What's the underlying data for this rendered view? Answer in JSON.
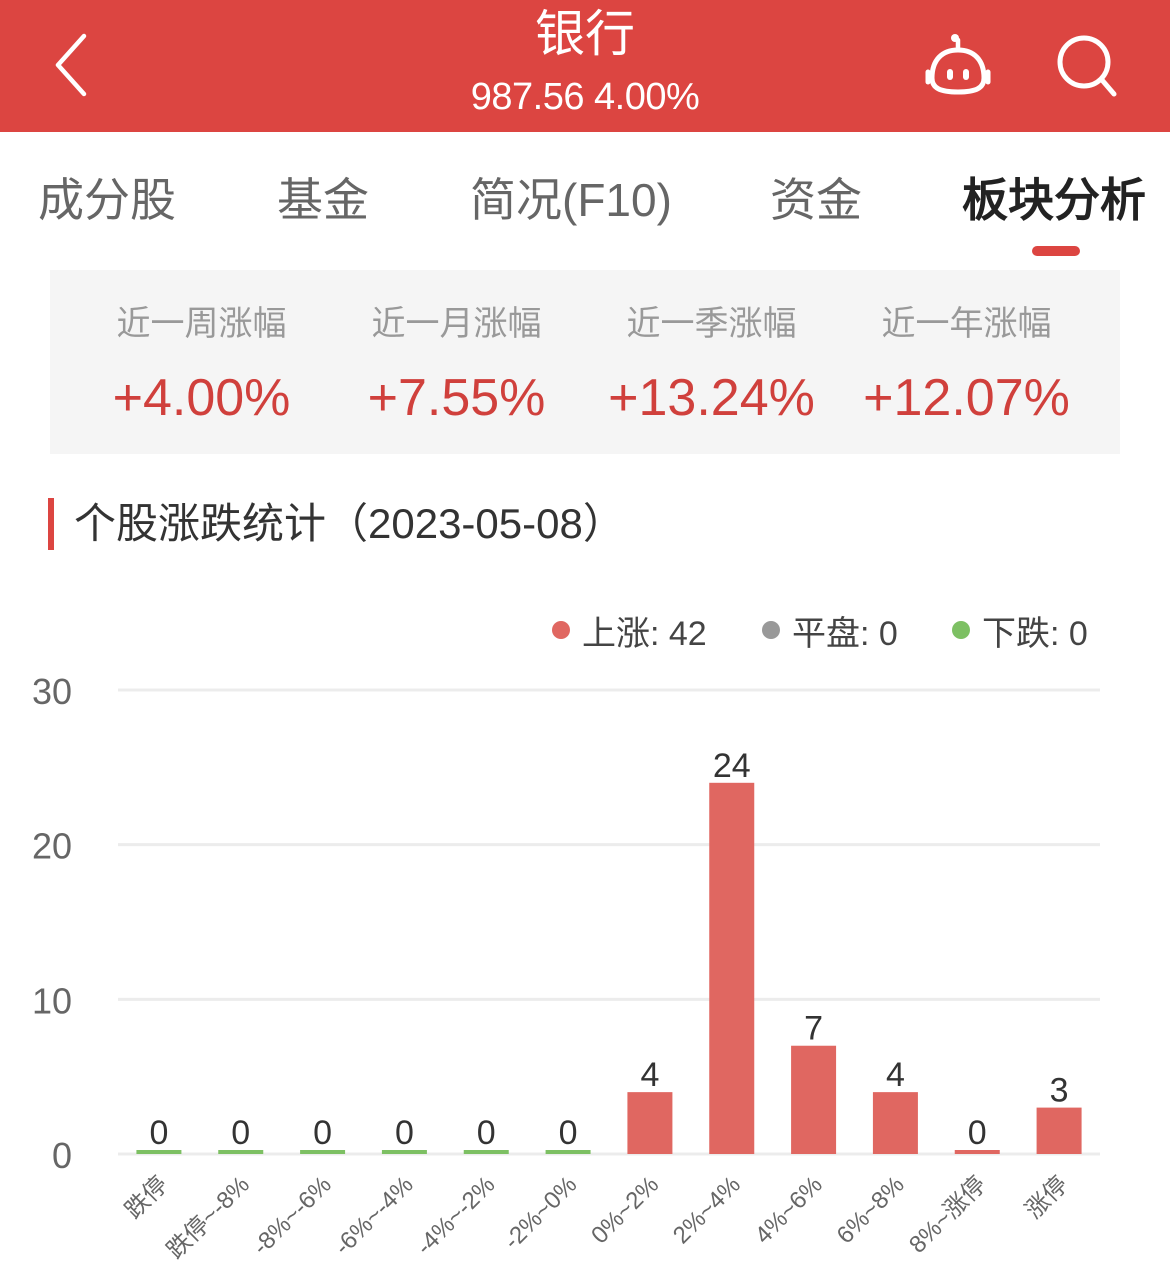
{
  "header": {
    "title": "银行",
    "price": "987.56",
    "change_pct": "4.00%",
    "subtitle": "987.56 4.00%",
    "icons": [
      "back-chevron-icon",
      "robot-assistant-icon",
      "search-icon"
    ]
  },
  "tabs": [
    {
      "label": "成分股",
      "active": false
    },
    {
      "label": "基金",
      "active": false
    },
    {
      "label": "简况(F10)",
      "active": false
    },
    {
      "label": "资金",
      "active": false
    },
    {
      "label": "板块分析",
      "active": true
    }
  ],
  "stats": [
    {
      "label": "近一周涨幅",
      "value": "+4.00%"
    },
    {
      "label": "近一月涨幅",
      "value": "+7.55%"
    },
    {
      "label": "近一季涨幅",
      "value": "+13.24%"
    },
    {
      "label": "近一年涨幅",
      "value": "+12.07%"
    }
  ],
  "section": {
    "title": "个股涨跌统计（2023-05-08）"
  },
  "legend": [
    {
      "label": "上涨",
      "value": "42",
      "text": "上涨: 42",
      "color": "#e06761"
    },
    {
      "label": "平盘",
      "value": "0",
      "text": "平盘: 0",
      "color": "#999999"
    },
    {
      "label": "下跌",
      "value": "0",
      "text": "下跌: 0",
      "color": "#7dc063"
    }
  ],
  "colors": {
    "brand_red": "#dc4541",
    "up": "#e06761",
    "down": "#7dc063",
    "flat": "#999999"
  },
  "chart_data": {
    "type": "bar",
    "title": "个股涨跌统计（2023-05-08）",
    "xlabel": "",
    "ylabel": "",
    "categories": [
      "跌停",
      "跌停~-8%",
      "-8%~-6%",
      "-6%~-4%",
      "-4%~-2%",
      "-2%~0%",
      "0%~2%",
      "2%~4%",
      "4%~6%",
      "6%~8%",
      "8%~涨停",
      "涨停"
    ],
    "values": [
      0,
      0,
      0,
      0,
      0,
      0,
      4,
      24,
      7,
      4,
      0,
      3
    ],
    "bar_colors": [
      "down",
      "down",
      "down",
      "down",
      "down",
      "down",
      "up",
      "up",
      "up",
      "up",
      "up",
      "up"
    ],
    "yticks": [
      0,
      10,
      20,
      30
    ],
    "ylim": [
      0,
      30
    ],
    "grid": true,
    "legend_position": "top-right",
    "data_labels": true
  }
}
